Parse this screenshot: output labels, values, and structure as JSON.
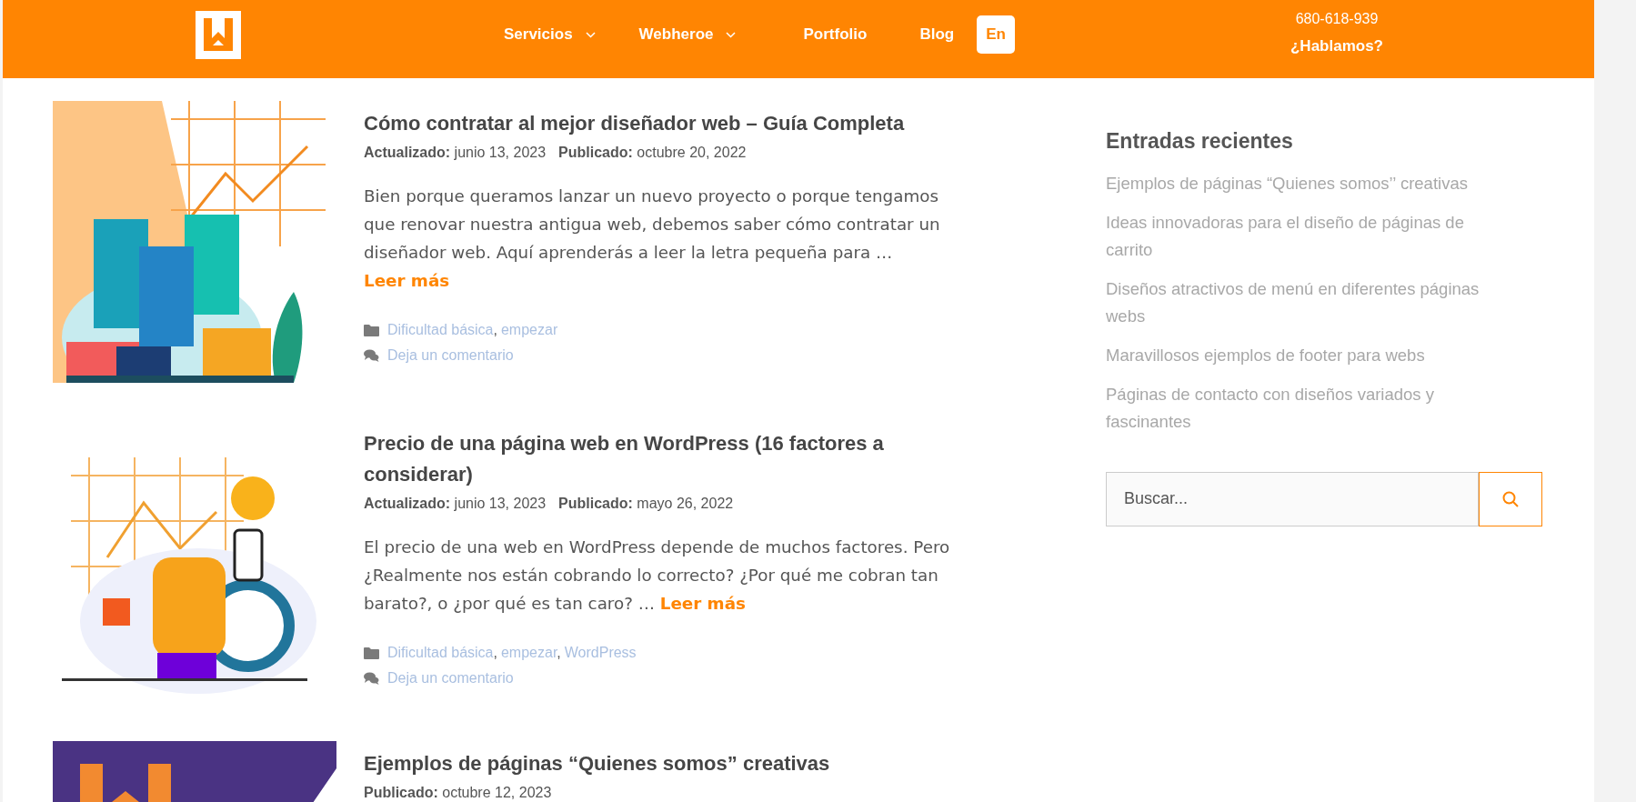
{
  "header": {
    "nav": [
      {
        "label": "Servicios",
        "dropdown": true
      },
      {
        "label": "Webheroe",
        "dropdown": true
      },
      {
        "label": "Portfolio",
        "dropdown": false
      },
      {
        "label": "Blog",
        "dropdown": false
      }
    ],
    "language": "En",
    "phone": "680-618-939",
    "cta": "¿Hablamos?"
  },
  "posts": [
    {
      "title": "Cómo contratar al mejor diseñador web – Guía Completa",
      "meta": [
        {
          "label": "Actualizado:",
          "value": "junio 13, 2023"
        },
        {
          "label": "Publicado:",
          "value": "octubre 20, 2022"
        }
      ],
      "excerpt": "Bien porque queramos lanzar un nuevo proyecto o porque tengamos que renovar nuestra antigua web, debemos saber cómo contratar un diseñador web. Aquí aprenderás a leer la letra pequeña para …",
      "read_more": "Leer más",
      "categories": [
        {
          "label": "Dificultad básica",
          "separator": ","
        },
        {
          "label": "empezar"
        }
      ],
      "comments": "Deja un comentario",
      "image": {
        "kind": "picture"
      }
    },
    {
      "title": "Precio de una página web en WordPress (16 factores a considerar)",
      "meta": [
        {
          "label": "Actualizado:",
          "value": "junio 13, 2023"
        },
        {
          "label": "Publicado:",
          "value": "mayo 26, 2022"
        }
      ],
      "excerpt": "El precio de una web en WordPress depende de muchos factores. Pero ¿Realmente nos están cobrando lo correcto? ¿Por qué me cobran tan barato?, o ¿por qué es tan caro? …",
      "read_more": "Leer más",
      "categories": [
        {
          "label": "Dificultad básica",
          "separator": ","
        },
        {
          "label": "empezar",
          "separator": ","
        },
        {
          "label": "WordPress"
        }
      ],
      "comments": "Deja un comentario",
      "image": {
        "kind": "picture"
      }
    },
    {
      "title": "Ejemplos de páginas “Quienes somos” creativas",
      "meta": [
        {
          "label": "Publicado:",
          "value": "octubre 12, 2023"
        }
      ],
      "image": {
        "kind": "picture"
      }
    }
  ],
  "sidebar": {
    "heading": "Entradas recientes",
    "recent": [
      "Ejemplos de páginas “Quienes somos’’ creativas",
      "Ideas innovadoras para el diseño de páginas de carrito",
      "Diseños atractivos de menú en diferentes páginas webs",
      "Maravillosos ejemplos de footer para webs",
      "Páginas de contacto con diseños variados y fascinantes"
    ],
    "search": {
      "placeholder": "Buscar..."
    }
  }
}
